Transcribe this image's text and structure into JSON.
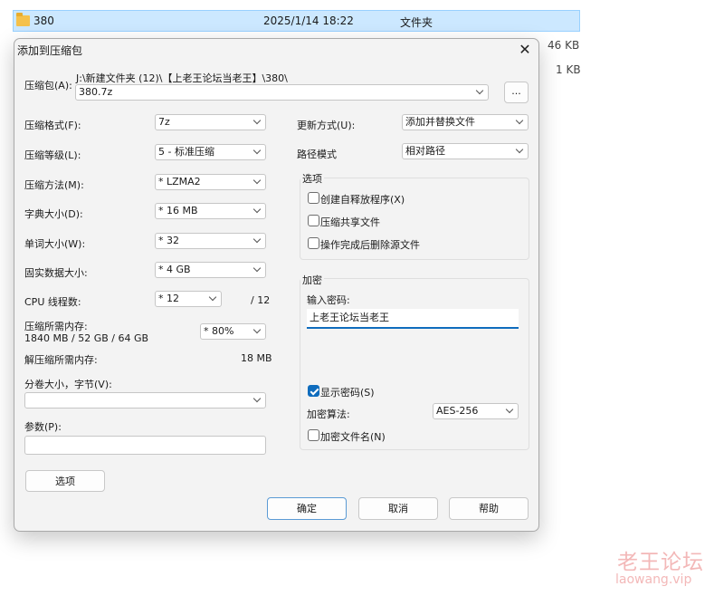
{
  "explorer": {
    "row": {
      "name": "380",
      "date": "2025/1/14 18:22",
      "type": "文件夹"
    },
    "sizes": [
      "46 KB",
      "1 KB"
    ]
  },
  "dialog": {
    "title": "添加到压缩包",
    "close": "✕",
    "archive_label": "压缩包(A):",
    "archive_path": "J:\\新建文件夹 (12)\\【上老王论坛当老王】\\380\\",
    "archive_name": "380.7z",
    "browse": "...",
    "left": {
      "format_label": "压缩格式(F):",
      "format_value": "7z",
      "level_label": "压缩等级(L):",
      "level_value": "5 - 标准压缩",
      "method_label": "压缩方法(M):",
      "method_value": "* LZMA2",
      "dict_label": "字典大小(D):",
      "dict_value": "* 16 MB",
      "word_label": "单词大小(W):",
      "word_value": "* 32",
      "solid_label": "固实数据大小:",
      "solid_value": "* 4 GB",
      "threads_label": "CPU 线程数:",
      "threads_value": "* 12",
      "threads_total": "/ 12",
      "mem_label": "压缩所需内存:",
      "mem_detail": "1840 MB / 52 GB / 64 GB",
      "mem_value": "* 80%",
      "decomp_label": "解压缩所需内存:",
      "decomp_value": "18 MB",
      "split_label": "分卷大小，字节(V):",
      "split_value": "",
      "params_label": "参数(P):",
      "params_value": "",
      "options_button": "选项"
    },
    "right": {
      "update_label": "更新方式(U):",
      "update_value": "添加并替换文件",
      "path_label": "路径模式",
      "path_value": "相对路径",
      "options_group": "选项",
      "opt_sfx": "创建自释放程序(X)",
      "opt_shared": "压缩共享文件",
      "opt_delete": "操作完成后删除源文件",
      "encrypt_group": "加密",
      "password_label": "输入密码:",
      "password_value": "上老王论坛当老王",
      "show_password": "显示密码(S)",
      "enc_method_label": "加密算法:",
      "enc_method_value": "AES-256",
      "encrypt_names": "加密文件名(N)"
    },
    "buttons": {
      "ok": "确定",
      "cancel": "取消",
      "help": "帮助"
    }
  },
  "watermark": {
    "cn": "老王论坛",
    "en": "laowang.vip"
  }
}
